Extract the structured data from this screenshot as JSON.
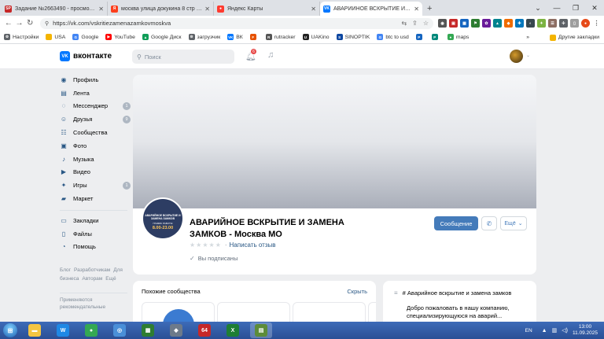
{
  "browser": {
    "tabs": [
      {
        "title": "Задание №2663490 - просмотр з",
        "fav_text": "SP",
        "fav_color": "#c62828",
        "active": false
      },
      {
        "title": "москва улица докукина 8 стр 2 и",
        "fav_text": "Я",
        "fav_color": "#fc3f1d",
        "active": false
      },
      {
        "title": "Яндекс Карты",
        "fav_text": "●",
        "fav_color": "#ff3b30",
        "active": false
      },
      {
        "title": "АВАРИЙНОЕ ВСКРЫТИЕ И ЗАМЕ",
        "fav_text": "VK",
        "fav_color": "#0077ff",
        "active": true
      }
    ],
    "new_tab": "+",
    "url": "https://vk.com/vskritiezamenazamkovmoskva",
    "bookmarks": [
      {
        "label": "Настройки",
        "color": "#5f6368",
        "txt": "⚙"
      },
      {
        "label": "USA",
        "color": "#f4b400",
        "txt": ""
      },
      {
        "label": "Google",
        "color": "#4285f4",
        "txt": "G"
      },
      {
        "label": "YouTube",
        "color": "#ff0000",
        "txt": "▶"
      },
      {
        "label": "Google Диск",
        "color": "#0f9d58",
        "txt": "▲"
      },
      {
        "label": "загрузчик",
        "color": "#5f6368",
        "txt": "⚙"
      },
      {
        "label": "ВК",
        "color": "#0077ff",
        "txt": "VK"
      },
      {
        "label": "",
        "color": "#e65100",
        "txt": "F"
      },
      {
        "label": "rutracker",
        "color": "#555555",
        "txt": "R"
      },
      {
        "label": "UAKino",
        "color": "#222222",
        "txt": "U"
      },
      {
        "label": "SINOPTIK",
        "color": "#0d47a1",
        "txt": "S"
      },
      {
        "label": "btc to usd",
        "color": "#4285f4",
        "txt": "G"
      },
      {
        "label": "",
        "color": "#1565c0",
        "txt": "P"
      },
      {
        "label": "",
        "color": "#00897b",
        "txt": "P"
      },
      {
        "label": "maps",
        "color": "#34a853",
        "txt": "●"
      }
    ],
    "bookmarks_more": "»",
    "other_bookmarks": "Другие закладки"
  },
  "vk": {
    "logo_text": "вконтакте",
    "search_placeholder": "Поиск",
    "notifications_count": "6",
    "sidebar": [
      {
        "label": "Профиль",
        "icon": "◉",
        "count": ""
      },
      {
        "label": "Лента",
        "icon": "▤",
        "count": ""
      },
      {
        "label": "Мессенджер",
        "icon": "◌",
        "count": "1"
      },
      {
        "label": "Друзья",
        "icon": "☺",
        "count": "9"
      },
      {
        "label": "Сообщества",
        "icon": "☷",
        "count": ""
      },
      {
        "label": "Фото",
        "icon": "▣",
        "count": ""
      },
      {
        "label": "Музыка",
        "icon": "♪",
        "count": ""
      },
      {
        "label": "Видео",
        "icon": "▶",
        "count": ""
      },
      {
        "label": "Игры",
        "icon": "✦",
        "count": "1"
      },
      {
        "label": "Маркет",
        "icon": "▰",
        "count": ""
      }
    ],
    "sidebar2": [
      {
        "label": "Закладки",
        "icon": "▭",
        "count": ""
      },
      {
        "label": "Файлы",
        "icon": "▯",
        "count": ""
      },
      {
        "label": "Помощь",
        "icon": "◔",
        "count": ""
      }
    ],
    "footer_links": [
      "Блог",
      "Разработчикам",
      "Для бизнеса",
      "Авторам",
      "Ещё"
    ],
    "footer_more": "Применяются рекомендательные",
    "community": {
      "title": "АВАРИЙНОЕ ВСКРЫТИЕ И ЗАМЕНА ЗАМКОВ - Москва МО",
      "avatar_line1": "АВАРИЙНОЕ ВСКРЫТИЕ И ЗАМЕНА ЗАМКОВ",
      "avatar_line2": "ГРАФИК РАБОТЫ",
      "avatar_line3": "8.00-23.00",
      "stars": "★★★★★",
      "review_link": "Написать отзыв",
      "subscribed": "Вы подписаны",
      "message_button": "Сообщение",
      "more_button": "Ещё"
    },
    "similar": {
      "header": "Похожие сообщества",
      "hide": "Скрыть",
      "cards": [
        {
          "color": "#3b7bd1"
        },
        {
          "color": "#ffffff"
        },
        {
          "color": "#ffffff"
        },
        {
          "color": "#f0a020"
        }
      ]
    },
    "info": {
      "header": "# Аварийное вскрытие и замена замков",
      "text": "Добро пожаловать в нашу компанию, специализирующуюся на аварий..."
    }
  },
  "taskbar": {
    "apps": [
      {
        "txt": "▬",
        "color": "#f4c542"
      },
      {
        "txt": "W",
        "color": "#1e88e5"
      },
      {
        "txt": "●",
        "color": "#34a853"
      },
      {
        "txt": "◎",
        "color": "#4a8fd8"
      },
      {
        "txt": "▦",
        "color": "#2e7d32"
      },
      {
        "txt": "◆",
        "color": "#6d7a8a"
      },
      {
        "txt": "64",
        "color": "#c62828"
      },
      {
        "txt": "X",
        "color": "#1e7e34"
      },
      {
        "txt": "▤",
        "color": "#5d8c3a"
      }
    ],
    "lang": "EN",
    "time": "13:00",
    "date": "11.09.2025"
  },
  "colors": {
    "vk_blue": "#0077ff",
    "vk_link": "#2a5885",
    "button_primary": "#447bba"
  }
}
